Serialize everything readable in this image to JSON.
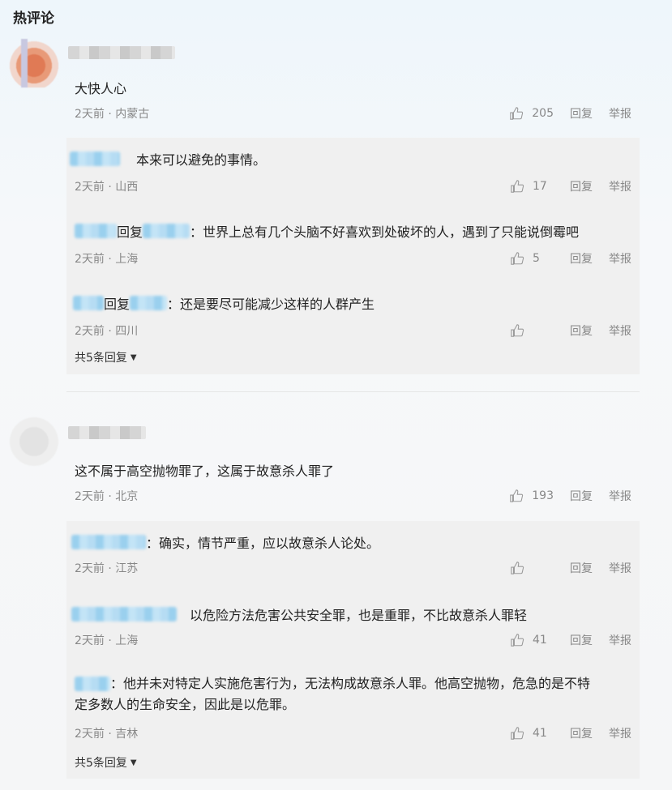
{
  "section_title": "热评论",
  "labels": {
    "reply": "回复",
    "report": "举报",
    "reply_connector": "回复"
  },
  "comments": [
    {
      "content": "大快人心",
      "meta": "2天前 · 内蒙古",
      "likes": "205",
      "replies": [
        {
          "text": "本来可以避免的事情。",
          "meta": "2天前 · 山西",
          "likes": "17"
        },
        {
          "text": "：世界上总有几个头脑不好喜欢到处破坏的人，遇到了只能说倒霉吧",
          "meta": "2天前 · 上海",
          "likes": "5"
        },
        {
          "text": "：还是要尽可能减少这样的人群产生",
          "meta": "2天前 · 四川",
          "likes": ""
        }
      ],
      "more_replies": "共5条回复"
    },
    {
      "content": "这不属于高空抛物罪了，这属于故意杀人罪了",
      "meta": "2天前 · 北京",
      "likes": "193",
      "replies": [
        {
          "text": "：确实，情节严重，应以故意杀人论处。",
          "meta": "2天前 · 江苏",
          "likes": ""
        },
        {
          "text": "以危险方法危害公共安全罪，也是重罪，不比故意杀人罪轻",
          "meta": "2天前 · 上海",
          "likes": "41"
        },
        {
          "text_line1": "：他并未对特定人实施危害行为，无法构成故意杀人罪。他高空抛物，危急的是不特",
          "text_line2": "定多数人的生命安全，因此是以危罪。",
          "meta": "2天前 · 吉林",
          "likes": "41"
        }
      ],
      "more_replies": "共5条回复"
    }
  ],
  "icons": {
    "like": "thumbs-up-icon",
    "expand": "caret-down-icon"
  },
  "colors": {
    "muted": "#888888",
    "reply_bg": "#f0f0f0",
    "blurred_name": "#9ad0ee"
  }
}
